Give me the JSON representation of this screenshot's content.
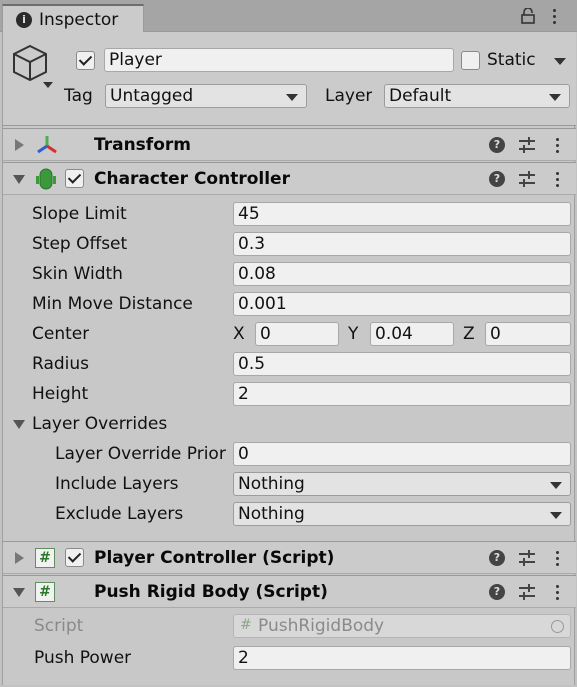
{
  "tab": {
    "title": "Inspector"
  },
  "gameobject": {
    "active": true,
    "name": "Player",
    "static_label": "Static",
    "tag_label": "Tag",
    "tag_value": "Untagged",
    "layer_label": "Layer",
    "layer_value": "Default"
  },
  "transform": {
    "title": "Transform"
  },
  "character_controller": {
    "enabled": true,
    "title": "Character Controller",
    "fields": {
      "slope_limit": {
        "label": "Slope Limit",
        "value": "45"
      },
      "step_offset": {
        "label": "Step Offset",
        "value": "0.3"
      },
      "skin_width": {
        "label": "Skin Width",
        "value": "0.08"
      },
      "min_move_distance": {
        "label": "Min Move Distance",
        "value": "0.001"
      },
      "center": {
        "label": "Center",
        "x_label": "X",
        "x": "0",
        "y_label": "Y",
        "y": "0.04",
        "z_label": "Z",
        "z": "0"
      },
      "radius": {
        "label": "Radius",
        "value": "0.5"
      },
      "height": {
        "label": "Height",
        "value": "2"
      }
    },
    "layer_overrides": {
      "label": "Layer Overrides",
      "priority": {
        "label": "Layer Override Prior",
        "value": "0"
      },
      "include": {
        "label": "Include Layers",
        "value": "Nothing"
      },
      "exclude": {
        "label": "Exclude Layers",
        "value": "Nothing"
      }
    }
  },
  "player_controller": {
    "enabled": true,
    "title": "Player Controller (Script)"
  },
  "push_rigid_body": {
    "title": "Push Rigid Body (Script)",
    "script_label": "Script",
    "script_value": "PushRigidBody",
    "push_power_label": "Push Power",
    "push_power_value": "2"
  },
  "icons": {
    "help": "?",
    "hash": "#",
    "info": "i"
  }
}
